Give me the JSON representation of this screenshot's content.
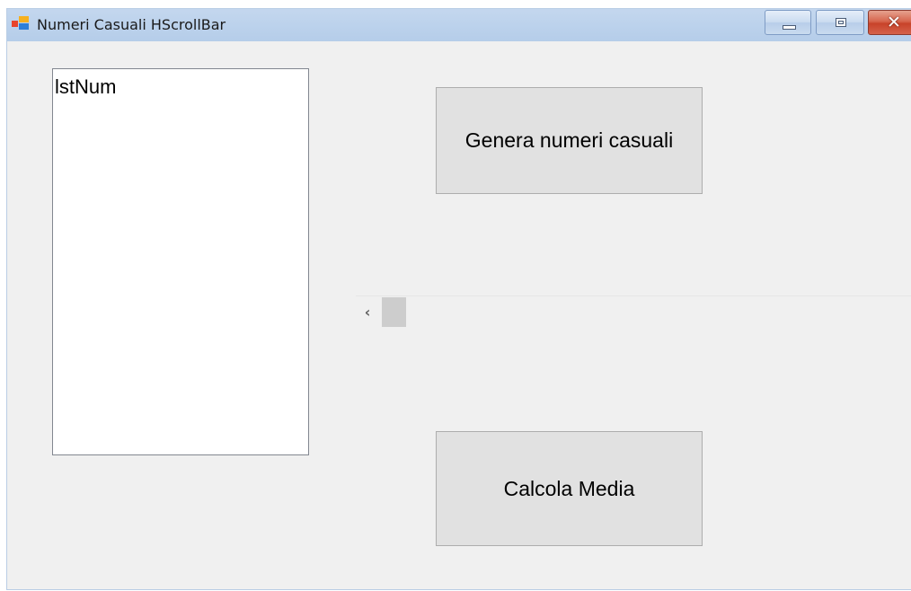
{
  "window": {
    "title": "Numeri Casuali HScrollBar",
    "icons": {
      "app": "windows-form-icon",
      "minimize": "minimize-icon",
      "maximize": "maximize-icon",
      "close": "close-icon"
    },
    "close_glyph": "✕"
  },
  "listbox": {
    "items": [
      "lstNum"
    ]
  },
  "buttons": {
    "genera_label": "Genera numeri casuali",
    "media_label": "Calcola Media"
  },
  "hscrollbar": {
    "left_arrow_glyph": "‹",
    "value_fraction": 0.0
  },
  "colors": {
    "form_background": "#f0f0f0",
    "button_background": "#e1e1e1",
    "titlebar": "#bcd2ec",
    "close_button": "#c8432a"
  }
}
